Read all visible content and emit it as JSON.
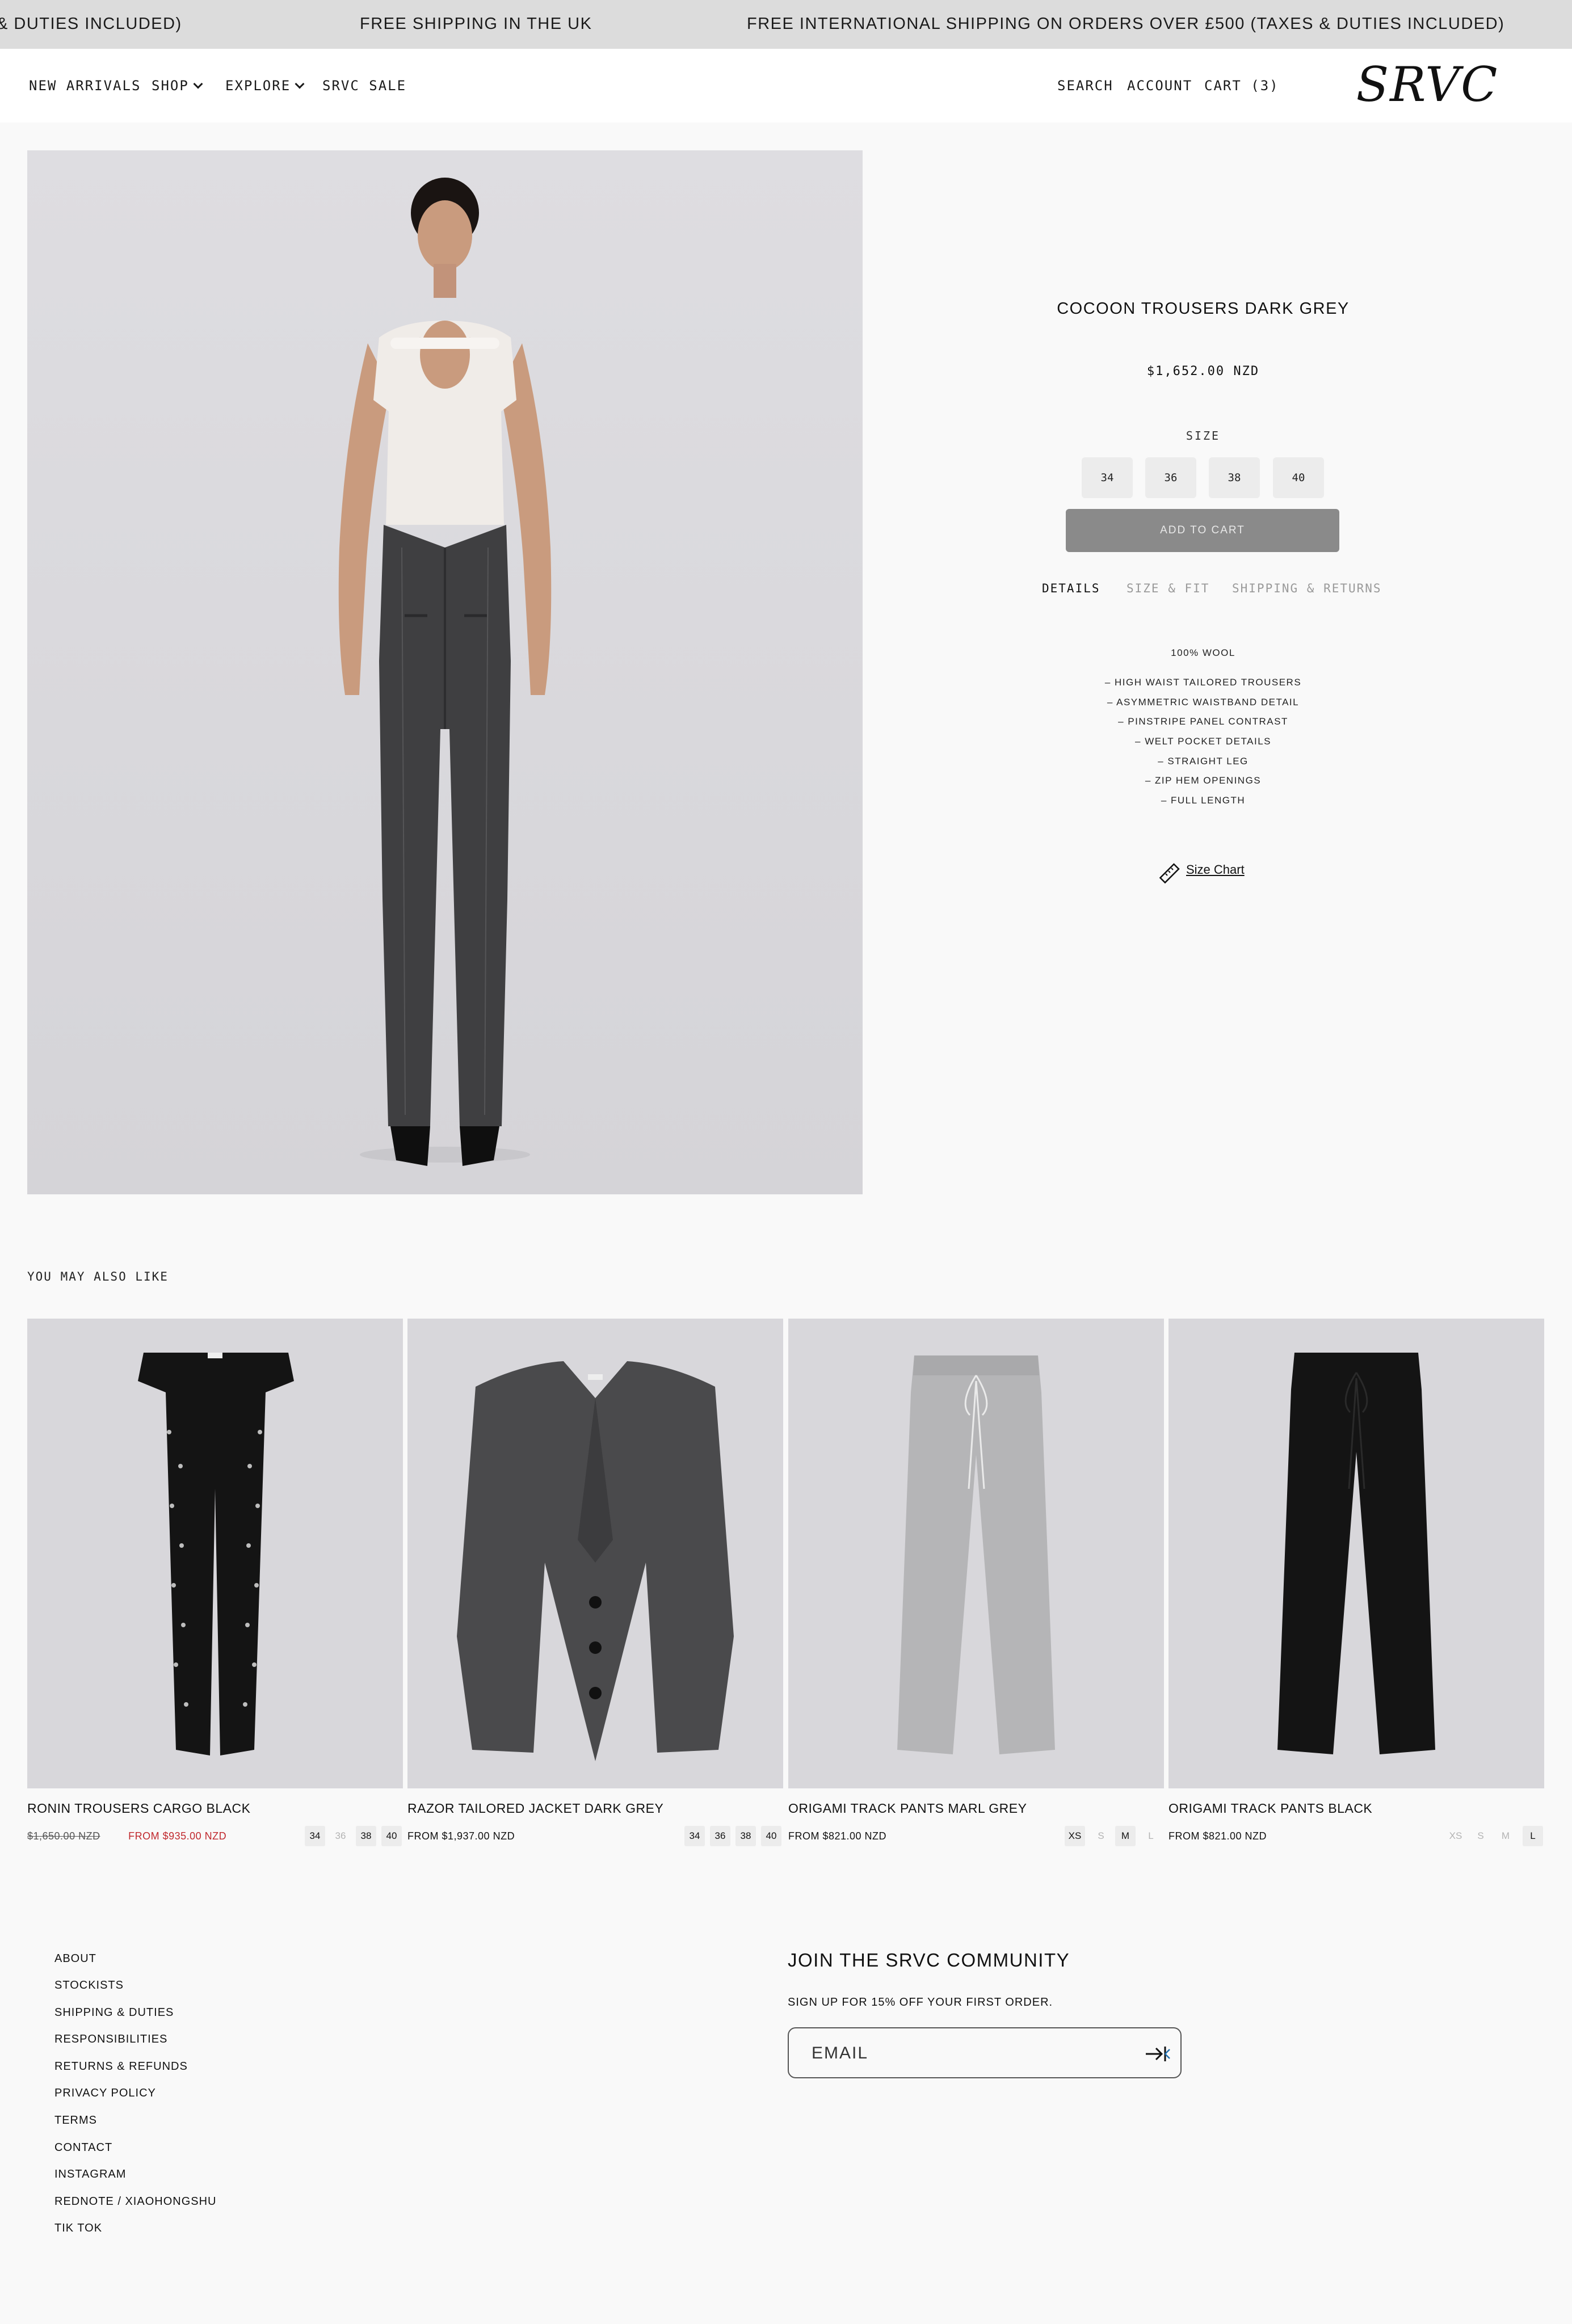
{
  "announcement": {
    "items": [
      "& DUTIES INCLUDED)",
      "FREE SHIPPING IN THE UK",
      "FREE INTERNATIONAL SHIPPING ON ORDERS OVER £500 (TAXES & DUTIES INCLUDED)"
    ]
  },
  "header": {
    "nav": {
      "new_arrivals": "NEW ARRIVALS",
      "shop": "SHOP",
      "explore": "EXPLORE",
      "sale": "SRVC SALE"
    },
    "utility": {
      "search": "SEARCH",
      "account": "ACCOUNT",
      "cart": "CART (3)"
    },
    "logo_text": "SRVC"
  },
  "product": {
    "title": "COCOON TROUSERS DARK GREY",
    "price": "$1,652.00 NZD",
    "size_label": "SIZE",
    "sizes": [
      "34",
      "36",
      "38",
      "40"
    ],
    "add_to_cart": "ADD TO CART",
    "tabs": {
      "details": "DETAILS",
      "size_fit": "SIZE & FIT",
      "shipping_returns": "SHIPPING & RETURNS"
    },
    "composition": "100% WOOL",
    "features": [
      "– HIGH WAIST TAILORED TROUSERS",
      "– ASYMMETRIC WAISTBAND DETAIL",
      "– PINSTRIPE PANEL CONTRAST",
      "– WELT POCKET DETAILS",
      "– STRAIGHT LEG",
      "– ZIP HEM OPENINGS",
      "– FULL LENGTH"
    ],
    "size_chart": "Size Chart"
  },
  "recommendations": {
    "heading": "YOU MAY ALSO LIKE",
    "items": [
      {
        "name": "RONIN TROUSERS CARGO BLACK",
        "compare_price": "$1,650.00 NZD",
        "price": "FROM $935.00 NZD",
        "sizes": [
          "34",
          "36",
          "38",
          "40"
        ]
      },
      {
        "name": "RAZOR TAILORED JACKET DARK GREY",
        "price": "FROM $1,937.00 NZD",
        "sizes": [
          "34",
          "36",
          "38",
          "40"
        ]
      },
      {
        "name": "ORIGAMI TRACK PANTS MARL GREY",
        "price": "FROM $821.00 NZD",
        "sizes": [
          "XS",
          "S",
          "M",
          "L"
        ]
      },
      {
        "name": "ORIGAMI TRACK PANTS BLACK",
        "price": "FROM $821.00 NZD",
        "sizes": [
          "XS",
          "S",
          "M",
          "L"
        ]
      }
    ]
  },
  "footer": {
    "links": [
      "ABOUT",
      "STOCKISTS",
      "SHIPPING & DUTIES",
      "RESPONSIBILITIES",
      "RETURNS & REFUNDS",
      "PRIVACY POLICY",
      "TERMS",
      "CONTACT",
      "INSTAGRAM",
      "REDNOTE / XIAOHONGSHU",
      "TIK TOK"
    ],
    "newsletter": {
      "title": "JOIN THE SRVC COMMUNITY",
      "subtitle": "SIGN UP FOR 15% OFF YOUR FIRST ORDER.",
      "placeholder": "EMAIL"
    }
  },
  "colors": {
    "announcement_bg": "#dcdcdc",
    "page_bg": "#f9f9f9",
    "add_to_cart_bg": "#8a8a8a",
    "sale_price": "#c0282d",
    "image_bg": "#d8d7db"
  }
}
